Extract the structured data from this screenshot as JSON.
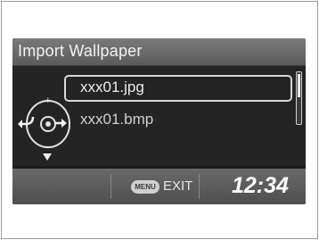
{
  "screen": {
    "title": "Import Wallpaper",
    "files": [
      {
        "name": "xxx01.jpg",
        "selected": true
      },
      {
        "name": "xxx01.bmp",
        "selected": false
      }
    ],
    "scroll_position": 0.0,
    "menu_label": "MENU",
    "exit_label": "EXIT",
    "clock": "12:34"
  },
  "icons": {
    "knob": "selector-knob-icon",
    "back": "back-arrow-icon",
    "enter": "enter-arrow-icon",
    "down": "down-triangle-icon"
  },
  "colors": {
    "screen_bg": "#1c1c1c",
    "bar": "#5b5b5b",
    "text": "#ededed"
  }
}
